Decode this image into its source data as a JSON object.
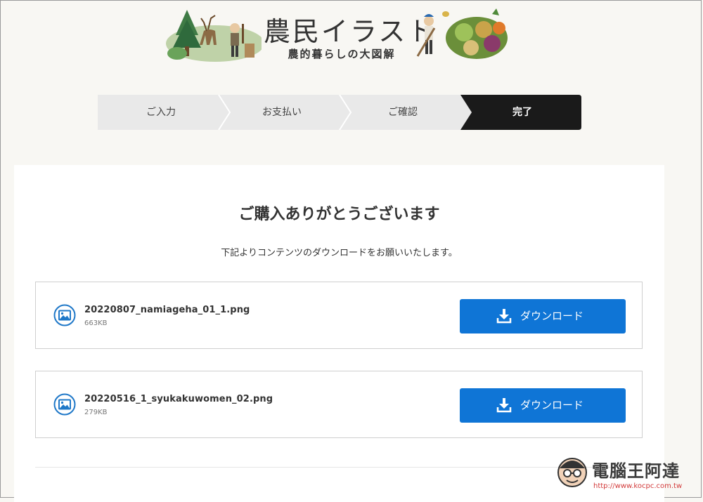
{
  "header": {
    "logo_title": "農民イラスト",
    "logo_subtitle": "農的暮らしの大図解"
  },
  "stepper": {
    "steps": [
      {
        "label": "ご入力",
        "active": false
      },
      {
        "label": "お支払い",
        "active": false
      },
      {
        "label": "ご確認",
        "active": false
      },
      {
        "label": "完了",
        "active": true
      }
    ]
  },
  "main": {
    "title": "ご購入ありがとうございます",
    "subtitle": "下記よりコンテンツのダウンロードをお願いいたします。",
    "files": [
      {
        "name": "20220807_namiageha_01_1.png",
        "size": "663KB",
        "download_label": "ダウンロード"
      },
      {
        "name": "20220516_1_syukakuwomen_02.png",
        "size": "279KB",
        "download_label": "ダウンロード"
      }
    ]
  },
  "watermark": {
    "text": "電腦王阿達",
    "url": "http://www.kocpc.com.tw"
  },
  "colors": {
    "accent": "#0f75d6",
    "active_step": "#1a1a1a",
    "inactive_step": "#e9e9e9"
  },
  "icons": [
    "image-file-icon",
    "download-icon"
  ]
}
